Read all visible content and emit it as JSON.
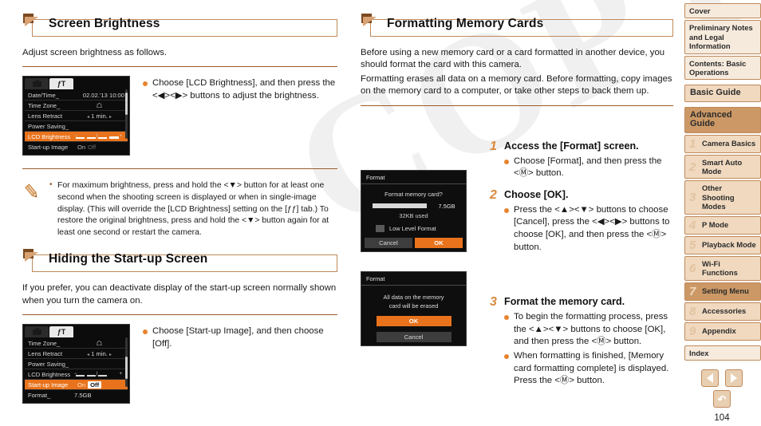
{
  "watermark": "COPY",
  "left_column": {
    "section1": {
      "title": "Screen Brightness",
      "intro": "Adjust screen brightness as follows.",
      "menu_screenshot": {
        "tabs": [
          "camera-tab",
          "settings-tab"
        ],
        "rows": [
          {
            "label": "Date/Time_",
            "value": "02.02.'13 10:00",
            "selected": false,
            "type": "text"
          },
          {
            "label": "Time Zone_",
            "value": "home-icon",
            "selected": false,
            "type": "icon"
          },
          {
            "label": "Lens Retract",
            "value": "1 min.",
            "selected": false,
            "type": "spinner"
          },
          {
            "label": "Power Saving_",
            "value": "",
            "selected": false,
            "type": "text"
          },
          {
            "label": "LCD Brightness",
            "value": "brightness-slider",
            "selected": true,
            "type": "slider"
          },
          {
            "label": "Start-up Image",
            "value": "On",
            "value_alt": "Off",
            "selected": false,
            "type": "onoff"
          }
        ]
      },
      "bullets": [
        "Choose [LCD Brightness], and then press the <◀><▶> buttons to adjust the brightness."
      ],
      "note": "For maximum brightness, press and hold the <▼> button for at least one second when the shooting screen is displayed or when in single-image display. (This will override the [LCD Brightness] setting on the [ƒƒ] tab.) To restore the original brightness, press and hold the <▼> button again for at least one second or restart the camera."
    },
    "section2": {
      "title": "Hiding the Start-up Screen",
      "intro": "If you prefer, you can deactivate display of the start-up screen normally shown when you turn the camera on.",
      "menu_screenshot": {
        "tabs": [
          "camera-tab",
          "settings-tab"
        ],
        "rows": [
          {
            "label": "Time Zone_",
            "value": "home-icon",
            "selected": false,
            "type": "icon"
          },
          {
            "label": "Lens Retract",
            "value": "1 min.",
            "selected": false,
            "type": "spinner"
          },
          {
            "label": "Power Saving_",
            "value": "",
            "selected": false,
            "type": "text"
          },
          {
            "label": "LCD Brightness",
            "value": "brightness-slider",
            "selected": false,
            "type": "slider"
          },
          {
            "label": "Start-up Image",
            "value": "On",
            "value_alt": "Off",
            "selected": true,
            "type": "onoff"
          },
          {
            "label": "Format_",
            "value": "7.5GB",
            "selected": false,
            "type": "text"
          }
        ]
      },
      "bullets": [
        "Choose [Start-up Image], and then choose [Off]."
      ]
    }
  },
  "right_column": {
    "section": {
      "title": "Formatting Memory Cards",
      "intro_paragraph_1": "Before using a new memory card or a card formatted in another device, you should format the card with this camera.",
      "intro_paragraph_2": "Formatting erases all data on a memory card. Before formatting, copy images on the memory card to a computer, or take other steps to back them up."
    },
    "steps": [
      {
        "num": "1",
        "title": "Access the [Format] screen.",
        "bullets": [
          "Choose [Format], and then press the <Ⓜ> button."
        ]
      },
      {
        "num": "2",
        "title": "Choose [OK].",
        "bullets": [
          "Press the <▲><▼> buttons to choose [Cancel], press the <◀><▶> buttons to choose [OK], and then press the <Ⓜ> button."
        ]
      },
      {
        "num": "3",
        "title": "Format the memory card.",
        "bullets": [
          "To begin the formatting process, press the <▲><▼> buttons to choose [OK], and then press the <Ⓜ> button.",
          "When formatting is finished, [Memory card formatting complete] is displayed. Press the <Ⓜ> button."
        ]
      }
    ],
    "dialog_format": {
      "title": "Format",
      "question": "Format memory card?",
      "capacity": "7.5GB",
      "used": "32KB used",
      "checkbox_label": "Low Level Format",
      "cancel_label": "Cancel",
      "ok_label": "OK"
    },
    "dialog_confirm": {
      "title": "Format",
      "message_line1": "All data on the memory",
      "message_line2": "card will be erased",
      "ok_label": "OK",
      "cancel_label": "Cancel"
    }
  },
  "sidebar": {
    "items": [
      {
        "label": "Cover",
        "num": "",
        "state": "plain"
      },
      {
        "label": "Preliminary Notes and Legal Information",
        "num": "",
        "state": "plain"
      },
      {
        "label": "Contents: Basic Operations",
        "num": "",
        "state": "plain"
      },
      {
        "label": "Basic Guide",
        "num": "",
        "state": "big"
      },
      {
        "label": "Advanced Guide",
        "num": "",
        "state": "active-big"
      },
      {
        "label": "Camera Basics",
        "num": "1",
        "state": "normal"
      },
      {
        "label": "Smart Auto Mode",
        "num": "2",
        "state": "normal"
      },
      {
        "label": "Other Shooting Modes",
        "num": "3",
        "state": "normal"
      },
      {
        "label": "P Mode",
        "num": "4",
        "state": "normal"
      },
      {
        "label": "Playback Mode",
        "num": "5",
        "state": "normal"
      },
      {
        "label": "Wi-Fi Functions",
        "num": "6",
        "state": "normal"
      },
      {
        "label": "Setting Menu",
        "num": "7",
        "state": "active"
      },
      {
        "label": "Accessories",
        "num": "8",
        "state": "normal"
      },
      {
        "label": "Appendix",
        "num": "9",
        "state": "normal"
      },
      {
        "label": "Index",
        "num": "",
        "state": "plain"
      }
    ]
  },
  "bottom_nav": {
    "prev_icon": "left-arrow-icon",
    "next_icon": "right-arrow-icon",
    "return_icon": "return-icon",
    "page_number": "104"
  },
  "colors": {
    "accent_orange": "#e8731c",
    "header_border": "#c08a5a",
    "rule_brown": "#9a5a2a",
    "sidebar_bg": "#f0d9bf",
    "sidebar_active": "#cc9966"
  }
}
